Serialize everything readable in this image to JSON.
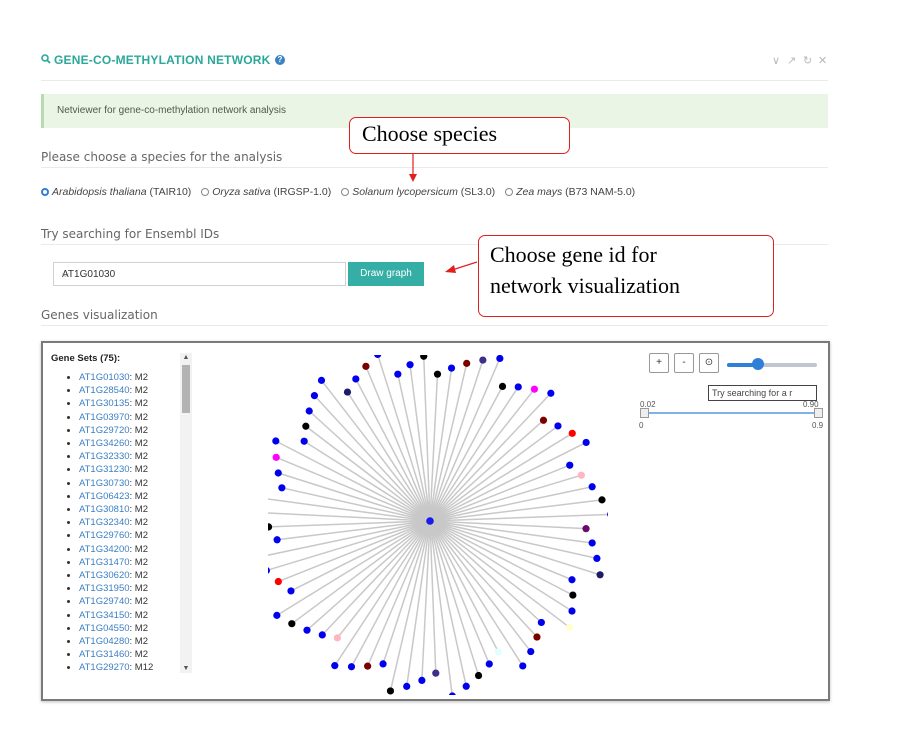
{
  "header": {
    "title": "GENE-CO-METHYLATION NETWORK",
    "help_glyph": "?",
    "controls": [
      "∨",
      "↗",
      "↻",
      "✕"
    ]
  },
  "info_text": "Netviewer for gene-co-methylation network analysis",
  "species_section": {
    "label": "Please choose a species for the analysis",
    "options": [
      {
        "species": "Arabidopsis thaliana",
        "build": "(TAIR10)",
        "selected": true
      },
      {
        "species": "Oryza sativa",
        "build": "(IRGSP-1.0)",
        "selected": false
      },
      {
        "species": "Solanum lycopersicum",
        "build": "(SL3.0)",
        "selected": false
      },
      {
        "species": "Zea mays",
        "build": "(B73 NAM-5.0)",
        "selected": false
      }
    ]
  },
  "search_section": {
    "label": "Try searching for Ensembl IDs",
    "selected_id": "AT1G01030",
    "draw_button": "Draw graph"
  },
  "viz_section": {
    "label": "Genes visualization",
    "gene_sets_title": "Gene Sets (75):",
    "genes": [
      {
        "id": "AT1G01030",
        "module": ": M2"
      },
      {
        "id": "AT1G28540",
        "module": ": M2"
      },
      {
        "id": "AT1G30135",
        "module": ": M2"
      },
      {
        "id": "AT1G03970",
        "module": ": M2"
      },
      {
        "id": "AT1G29720",
        "module": ": M2"
      },
      {
        "id": "AT1G34260",
        "module": ": M2"
      },
      {
        "id": "AT1G32330",
        "module": ": M2"
      },
      {
        "id": "AT1G31230",
        "module": ": M2"
      },
      {
        "id": "AT1G30730",
        "module": ": M2"
      },
      {
        "id": "AT1G06423",
        "module": ": M2"
      },
      {
        "id": "AT1G30810",
        "module": ": M2"
      },
      {
        "id": "AT1G32340",
        "module": ": M2"
      },
      {
        "id": "AT1G29760",
        "module": ": M2"
      },
      {
        "id": "AT1G34200",
        "module": ": M2"
      },
      {
        "id": "AT1G31470",
        "module": ": M2"
      },
      {
        "id": "AT1G30620",
        "module": ": M2"
      },
      {
        "id": "AT1G31950",
        "module": ": M2"
      },
      {
        "id": "AT1G29740",
        "module": ": M2"
      },
      {
        "id": "AT1G34150",
        "module": ": M2"
      },
      {
        "id": "AT1G04550",
        "module": ": M2"
      },
      {
        "id": "AT1G04280",
        "module": ": M2"
      },
      {
        "id": "AT1G31460",
        "module": ": M2"
      },
      {
        "id": "AT1G29270",
        "module": ": M12"
      }
    ],
    "graph_buttons": {
      "zoom_in": "+",
      "zoom_out": "-",
      "reset": "⊙"
    },
    "zoom_level": 0.35,
    "search_placeholder": "Try searching for a r",
    "threshold_slider": {
      "value_low": "0.02",
      "value_high": "0.90",
      "min": "0",
      "max": "0.9"
    }
  },
  "network": {
    "hub_color": "#1a1aee",
    "edge_color": "#c8c8c8",
    "node_colors": [
      "#0000ee",
      "#000000",
      "#7a0000",
      "#3b2f8c",
      "#ff00ff",
      "#ff0000",
      "#ffb6c1",
      "#6a0a6a",
      "#1c1c6a",
      "#ffffcc",
      "#e0ffff"
    ]
  },
  "annotations": {
    "species_callout": "Choose species",
    "gene_callout_line1": "Choose gene id for",
    "gene_callout_line2": "network visualization",
    "arrow_color": "#e02020"
  }
}
